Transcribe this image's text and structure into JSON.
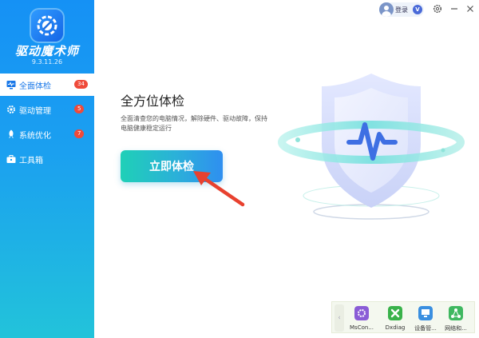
{
  "app": {
    "name": "驱动魔术师",
    "version": "9.3.11.26"
  },
  "nav": [
    {
      "label": "全面体检",
      "badge": "34",
      "icon": "monitor-check-icon",
      "active": true
    },
    {
      "label": "驱动管理",
      "badge": "5",
      "icon": "gear-icon",
      "active": false
    },
    {
      "label": "系统优化",
      "badge": "7",
      "icon": "rocket-icon",
      "active": false
    },
    {
      "label": "工具箱",
      "badge": "",
      "icon": "toolbox-icon",
      "active": false
    }
  ],
  "topbar": {
    "login_label": "登录",
    "vip_label": "V"
  },
  "main": {
    "headline": "全方位体检",
    "description": "全面清查您的电脑情况，解除硬件、驱动故障，保持电脑健康稳定运行",
    "check_button": "立即体检"
  },
  "tools": [
    {
      "label": "MsCon...",
      "icon": "mscon-icon",
      "color": "#8a5cd6"
    },
    {
      "label": "Dxdiag",
      "icon": "dxdiag-icon",
      "color": "#39b24a"
    },
    {
      "label": "设备管...",
      "icon": "device-manager-icon",
      "color": "#3a8fe0"
    },
    {
      "label": "网络和...",
      "icon": "network-icon",
      "color": "#3fb860"
    }
  ],
  "colors": {
    "sidebar_top": "#1591f5",
    "sidebar_bottom": "#22c3da",
    "badge": "#ef4a3a",
    "accent": "#1a78e8"
  }
}
